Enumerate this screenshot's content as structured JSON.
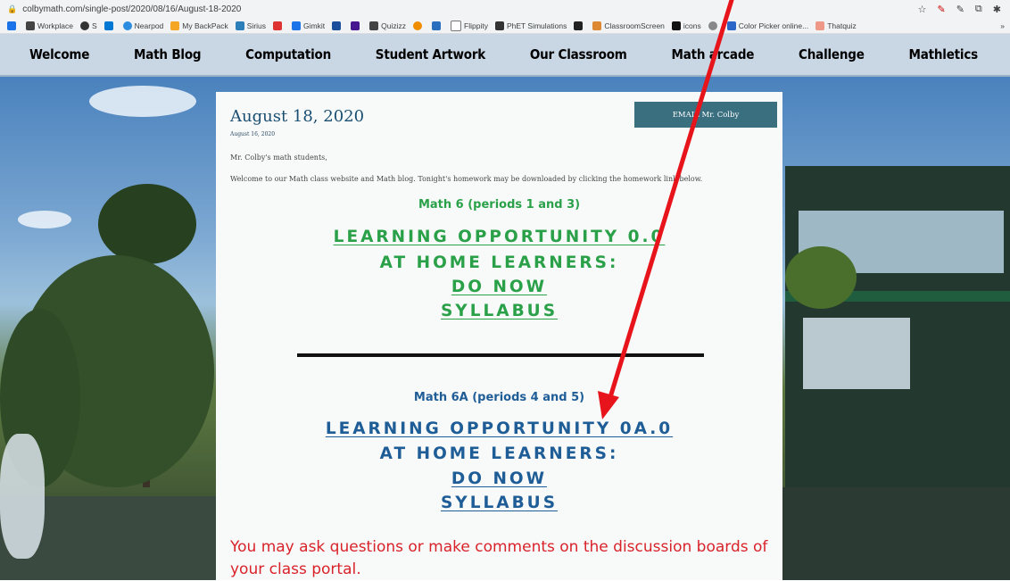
{
  "browser": {
    "url": "colbymath.com/single-post/2020/08/16/August-18-2020",
    "bookmarks": [
      "Workplace",
      "S",
      "Nearpod",
      "My BackPack",
      "Sirius",
      "Gimkit",
      "Quizizz",
      "Flippity",
      "PhET Simulations",
      "ClassroomScreen",
      "icons",
      "Color Picker online...",
      "Thatquiz"
    ],
    "more": "»"
  },
  "nav": {
    "items": [
      "Welcome",
      "Math Blog",
      "Computation",
      "Student Artwork",
      "Our Classroom",
      "Math arcade",
      "Challenge",
      "Mathletics"
    ]
  },
  "post": {
    "title": "August 18, 2020",
    "date": "August 16, 2020",
    "email_button": "EMAIL Mr. Colby",
    "greeting": "Mr. Colby's math students,",
    "welcome": "Welcome to our Math class website and Math blog. Tonight's homework may be downloaded by clicking the homework link below.",
    "math6": {
      "heading": "Math 6 (periods 1 and 3)",
      "learning": "LEARNING OPPORTUNITY 0.0",
      "at_home": "AT HOME LEARNERS:",
      "do_now": "DO NOW",
      "syllabus": "SYLLABUS"
    },
    "math6a": {
      "heading": "Math 6A (periods 4 and 5)",
      "learning": "LEARNING OPPORTUNITY 0A.0",
      "at_home": "AT HOME LEARNERS:",
      "do_now": "DO NOW",
      "syllabus": "SYLLABUS"
    },
    "questions": "You may ask questions or make comments on the discussion boards of your class portal."
  },
  "colors": {
    "nav_bg": "#c9d6e4",
    "green_text": "#2aa148",
    "blue_text": "#1f5d97",
    "red_text": "#d9232a",
    "email_btn": "#3a6f80",
    "arrow": "#e8141b"
  }
}
